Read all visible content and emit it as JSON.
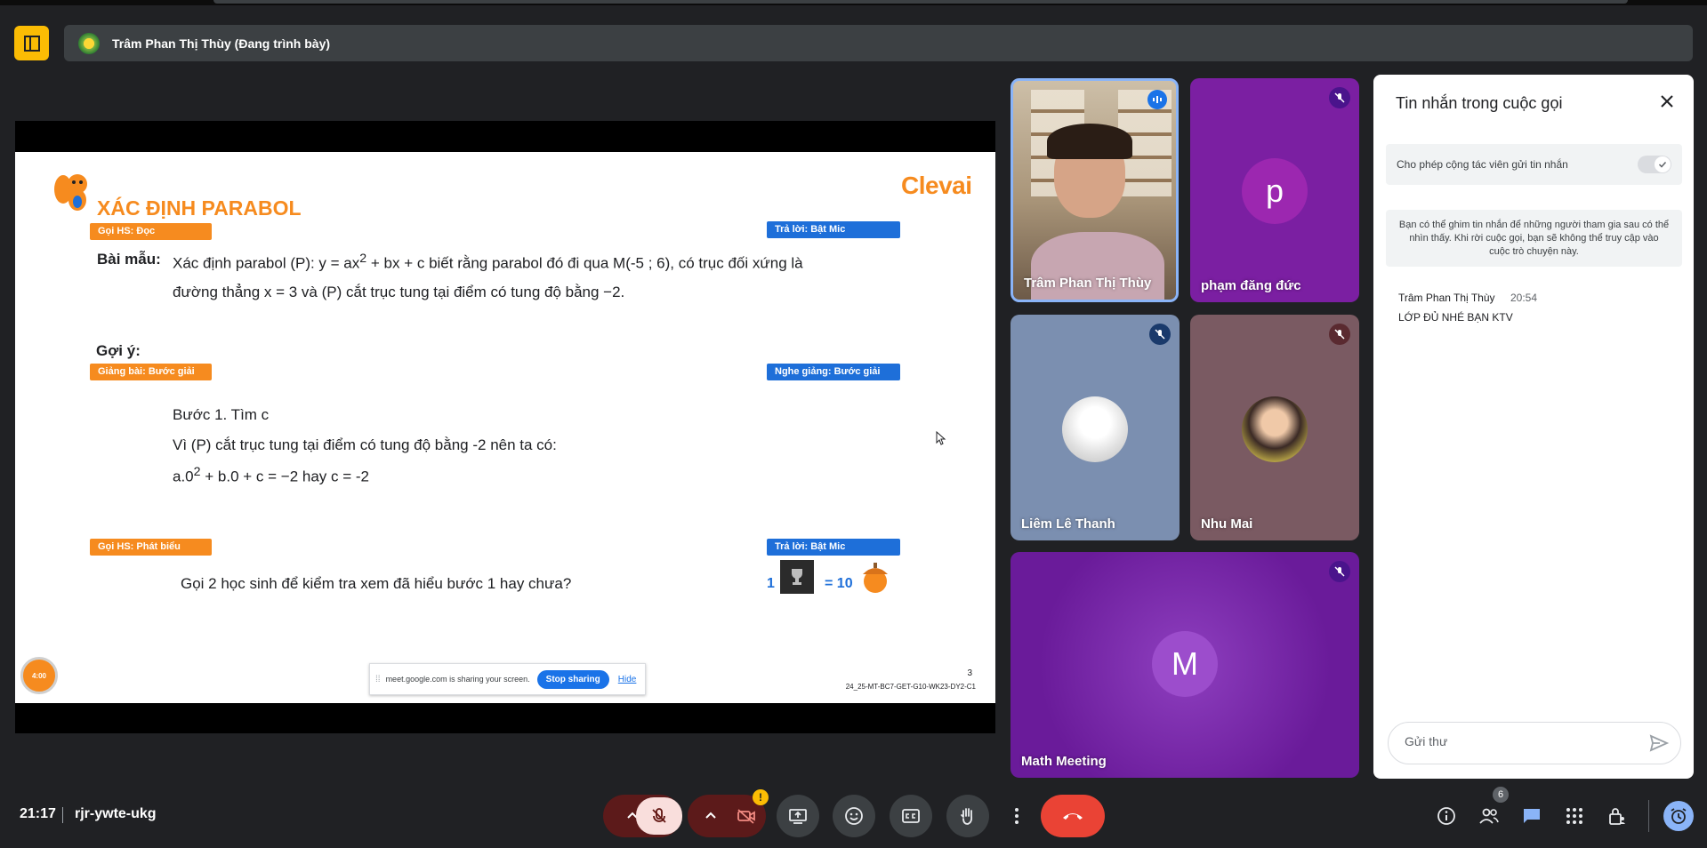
{
  "header": {
    "presenter_label": "Trâm Phan Thị Thùy (Đang trình bày)"
  },
  "slide": {
    "brand": "Clevai",
    "title": "XÁC ĐỊNH PARABOL",
    "tags": {
      "goi_hs_doc": "Gọi HS: Đọc",
      "tra_loi_bat_mic_1": "Trả lời: Bật Mic",
      "giang_bai": "Giảng bài: Bước giải",
      "nghe_giang": "Nghe giảng: Bước giải",
      "goi_hs_phat_bieu": "Gọi HS: Phát biểu",
      "tra_loi_bat_mic_2": "Trả lời: Bật Mic"
    },
    "bai_mau_label": "Bài mẫu:",
    "bai_mau_line1_a": "Xác định parabol (P): y = ax",
    "bai_mau_line1_sup": "2",
    "bai_mau_line1_b": " + bx + c biết rằng parabol đó đi qua M(-5 ; 6), có trục đối xứng là",
    "bai_mau_line2": "đường thẳng x = 3 và (P) cắt trục tung tại điểm có tung độ bằng −2.",
    "goi_y_label": "Gợi ý:",
    "buoc1": "Bước 1. Tìm c",
    "buoc1_line2": "Vì (P) cắt trục tung tại điểm có tung độ bằng -2 nên ta có:",
    "buoc1_line3_a": "a.0",
    "buoc1_line3_sup": "2",
    "buoc1_line3_b": " + b.0 + c = −2 hay c = -2",
    "question": "Gọi 2 học sinh để kiểm tra xem đã hiểu bước 1 hay chưa?",
    "reward_count": "1",
    "reward_value": "= 10",
    "timer": "4:00",
    "page_number": "3",
    "slide_code": "24_25-MT-BC7-GET-G10-WK23-DY2-C1",
    "share_msg": "meet.google.com is sharing your screen.",
    "stop_sharing": "Stop sharing",
    "hide": "Hide"
  },
  "participants": [
    {
      "name": "Trâm Phan Thị Thùy"
    },
    {
      "name": "phạm đăng đức",
      "initial": "p"
    },
    {
      "name": "Liêm Lê Thanh"
    },
    {
      "name": "Nhu Mai"
    },
    {
      "name": "Math Meeting",
      "initial": "M"
    }
  ],
  "chat": {
    "title": "Tin nhắn trong cuộc gọi",
    "toggle_label": "Cho phép cộng tác viên gửi tin nhắn",
    "info": "Bạn có thể ghim tin nhắn để những người tham gia sau có thể nhìn thấy. Khi rời cuộc gọi, bạn sẽ không thể truy cập vào cuộc trò chuyện này.",
    "messages": [
      {
        "sender": "Trâm Phan Thị Thùy",
        "time": "20:54",
        "text": "LỚP ĐỦ NHÉ BẠN KTV"
      }
    ],
    "input_placeholder": "Gửi thư"
  },
  "bottom": {
    "time": "21:17",
    "meeting_code": "rjr-ywte-ukg",
    "people_count": "6",
    "warning": "!"
  },
  "colors": {
    "accent_orange": "#f68b1f",
    "tag_blue": "#1e6fd9",
    "leave_red": "#ea4335",
    "chat_blue": "#8ab4f8"
  }
}
